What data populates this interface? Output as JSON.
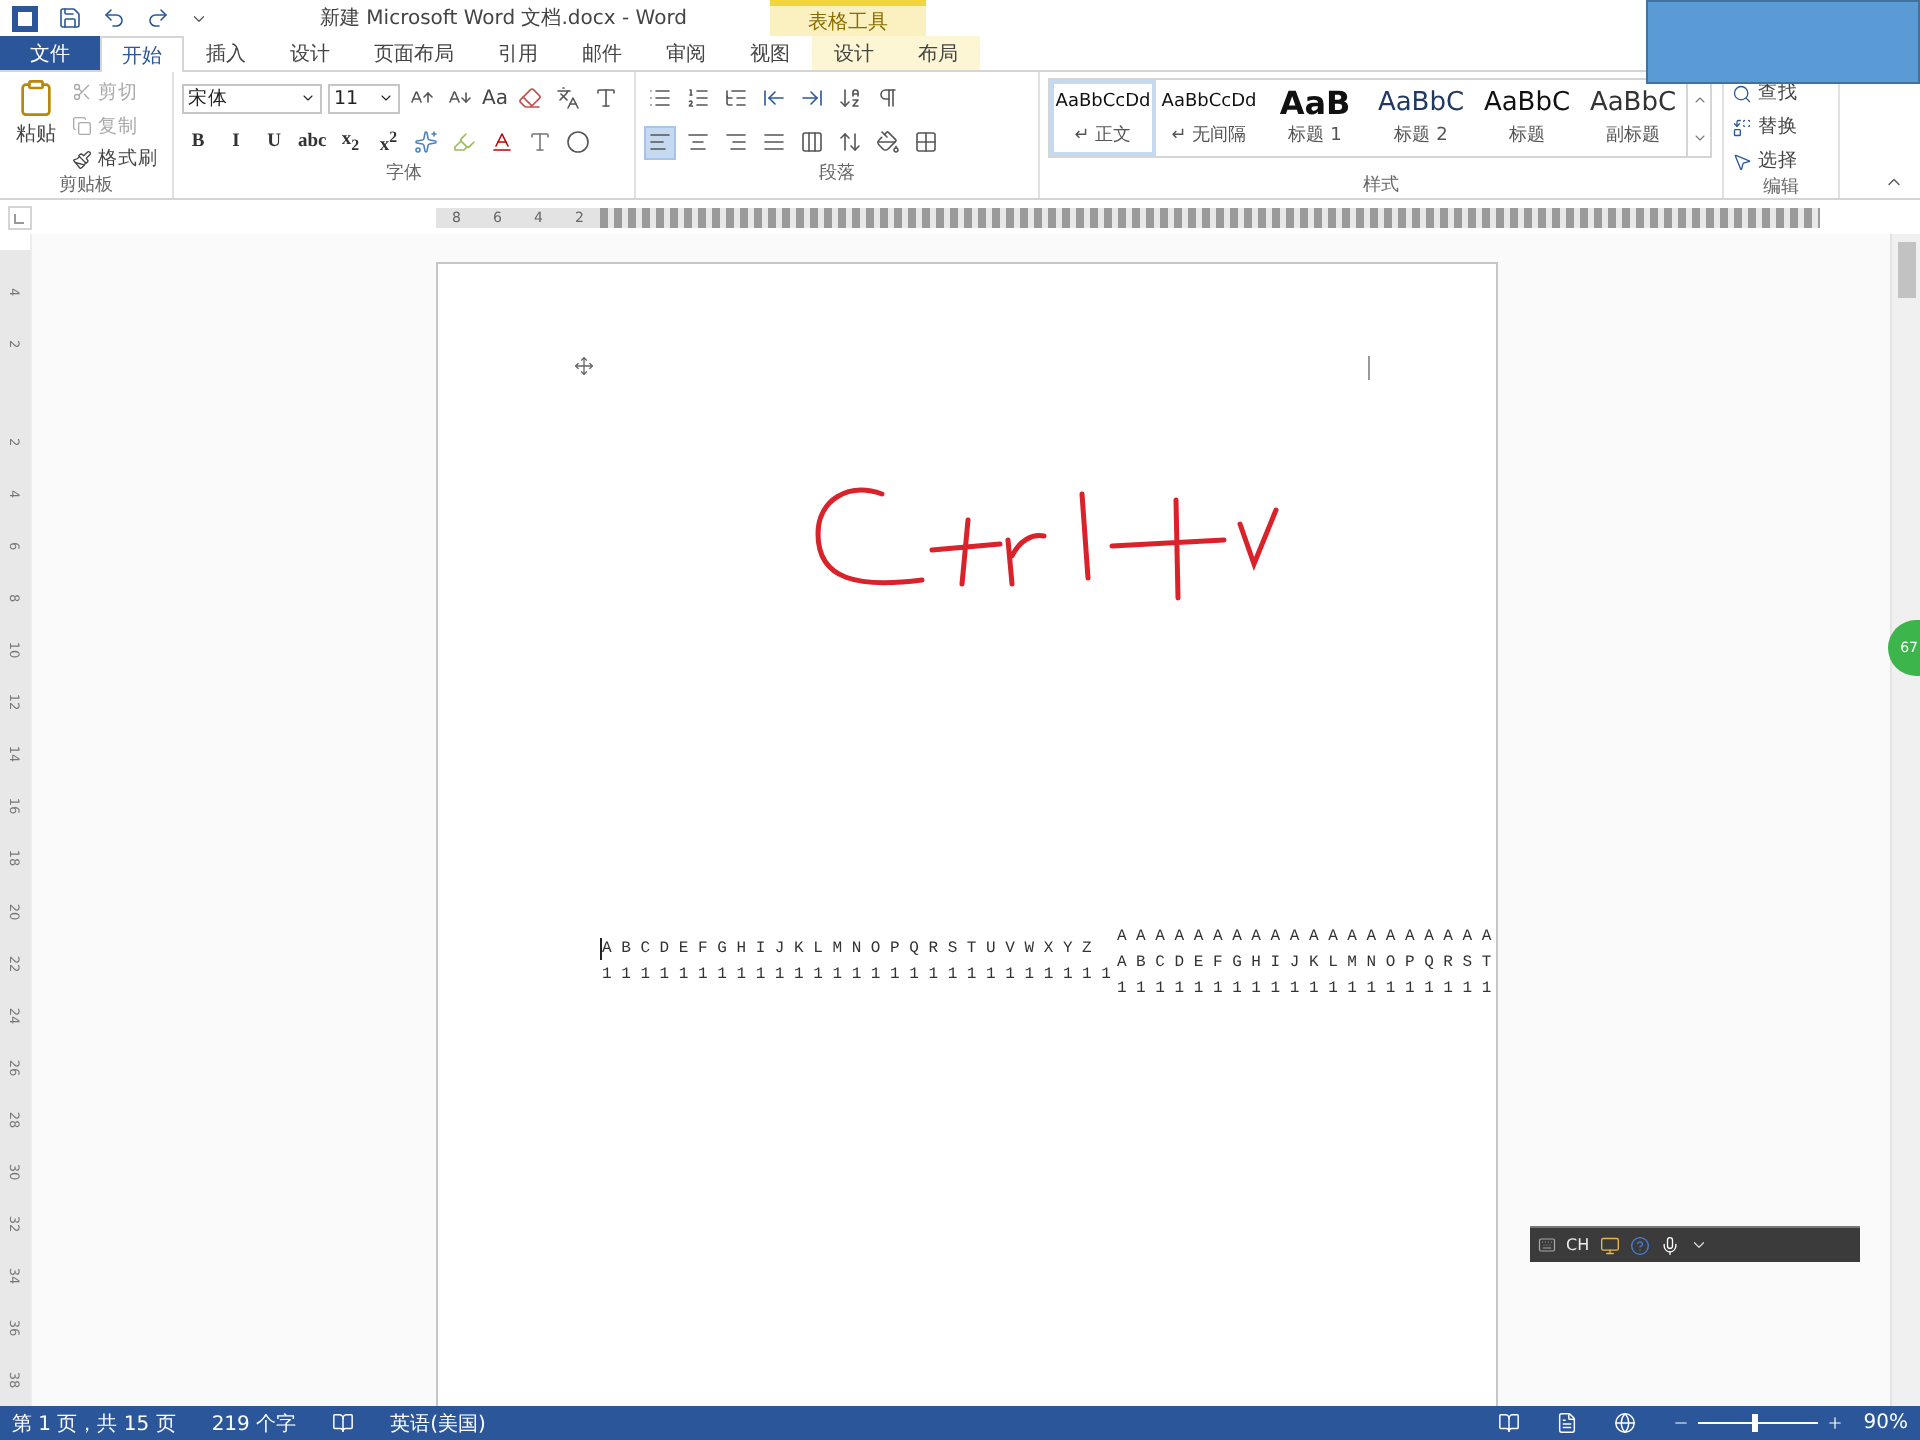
{
  "title_bar": {
    "title": "新建 Microsoft Word 文档.docx - Word",
    "context_group": "表格工具"
  },
  "tabs": [
    {
      "label": "文件",
      "kind": "file",
      "selected": false
    },
    {
      "label": "开始",
      "kind": "normal",
      "selected": true
    },
    {
      "label": "插入",
      "kind": "normal",
      "selected": false
    },
    {
      "label": "设计",
      "kind": "normal",
      "selected": false
    },
    {
      "label": "页面布局",
      "kind": "normal",
      "selected": false
    },
    {
      "label": "引用",
      "kind": "normal",
      "selected": false
    },
    {
      "label": "邮件",
      "kind": "normal",
      "selected": false
    },
    {
      "label": "审阅",
      "kind": "normal",
      "selected": false
    },
    {
      "label": "视图",
      "kind": "normal",
      "selected": false
    },
    {
      "label": "设计",
      "kind": "context",
      "selected": false
    },
    {
      "label": "布局",
      "kind": "context",
      "selected": false
    }
  ],
  "clipboard": {
    "label": "剪贴板",
    "paste": "粘贴",
    "items": [
      {
        "label": "剪切",
        "kind": "cut",
        "disabled": true
      },
      {
        "label": "复制",
        "kind": "copy",
        "disabled": true
      },
      {
        "label": "格式刷",
        "kind": "painter",
        "disabled": false
      }
    ]
  },
  "font": {
    "label": "字体",
    "font_name": "宋体",
    "font_size": "11",
    "case_button": "Aa",
    "format_buttons": [
      "B",
      "I",
      "U",
      "abc",
      "x$_{2}$",
      "x$^{2}$"
    ]
  },
  "paragraph": {
    "label": "段落",
    "alignments": [
      {
        "kind": "left",
        "selected": true
      },
      {
        "kind": "center",
        "selected": false
      },
      {
        "kind": "right",
        "selected": false
      },
      {
        "kind": "justify",
        "selected": false
      },
      {
        "kind": "distributed",
        "selected": false
      }
    ]
  },
  "styles": {
    "label": "样式",
    "items": [
      {
        "preview": "AaBbCcDd",
        "name": "↵ 正文",
        "kind": "body",
        "selected": true
      },
      {
        "preview": "AaBbCcDd",
        "name": "↵ 无间隔",
        "kind": "body",
        "selected": false
      },
      {
        "preview": "AaB",
        "name": "标题 1",
        "kind": "heading1",
        "selected": false
      },
      {
        "preview": "AaBbC",
        "name": "标题 2",
        "kind": "heading2",
        "selected": false
      },
      {
        "preview": "AaBbC",
        "name": "标题",
        "kind": "title",
        "selected": false
      },
      {
        "preview": "AaBbC",
        "name": "副标题",
        "kind": "subtitle",
        "selected": false
      }
    ]
  },
  "editing": {
    "label": "编辑",
    "items": [
      {
        "label": "查找",
        "kind": "find"
      },
      {
        "label": "替换",
        "kind": "replace"
      },
      {
        "label": "选择",
        "kind": "select"
      }
    ]
  },
  "ruler": {
    "numbers": [
      "8",
      "6",
      "4",
      "2"
    ]
  },
  "vertical_ruler": {
    "numbers": [
      "4",
      "2",
      "2",
      "4",
      "6",
      "8",
      "10",
      "12",
      "14",
      "16",
      "18",
      "20",
      "22",
      "24",
      "26",
      "28",
      "30",
      "32",
      "34",
      "36",
      "38"
    ]
  },
  "document": {
    "column_1": [
      "A B C D E F G H I J K L M N O P Q R S T U V W X Y Z",
      "1 1 1 1 1 1 1 1 1 1 1 1 1 1 1 1 1 1 1 1 1 1 1 1 1 1 1"
    ],
    "column_2": [
      "A A A A A A A A A A A A A A A A A A A A",
      "A B C D E F G H I J K L M N O P Q R S T",
      "1 1 1 1 1 1 1 1 1 1 1 1 1 1 1 1 1 1 1 1"
    ]
  },
  "side_badge": {
    "label": "67"
  },
  "ime_toolbar": {
    "language": "CH"
  },
  "status_bar": {
    "page": "第 1 页，共 15 页",
    "words": "219 个字",
    "language": "英语(美国)",
    "zoom": {
      "level": 0.47,
      "label": "90%"
    }
  }
}
